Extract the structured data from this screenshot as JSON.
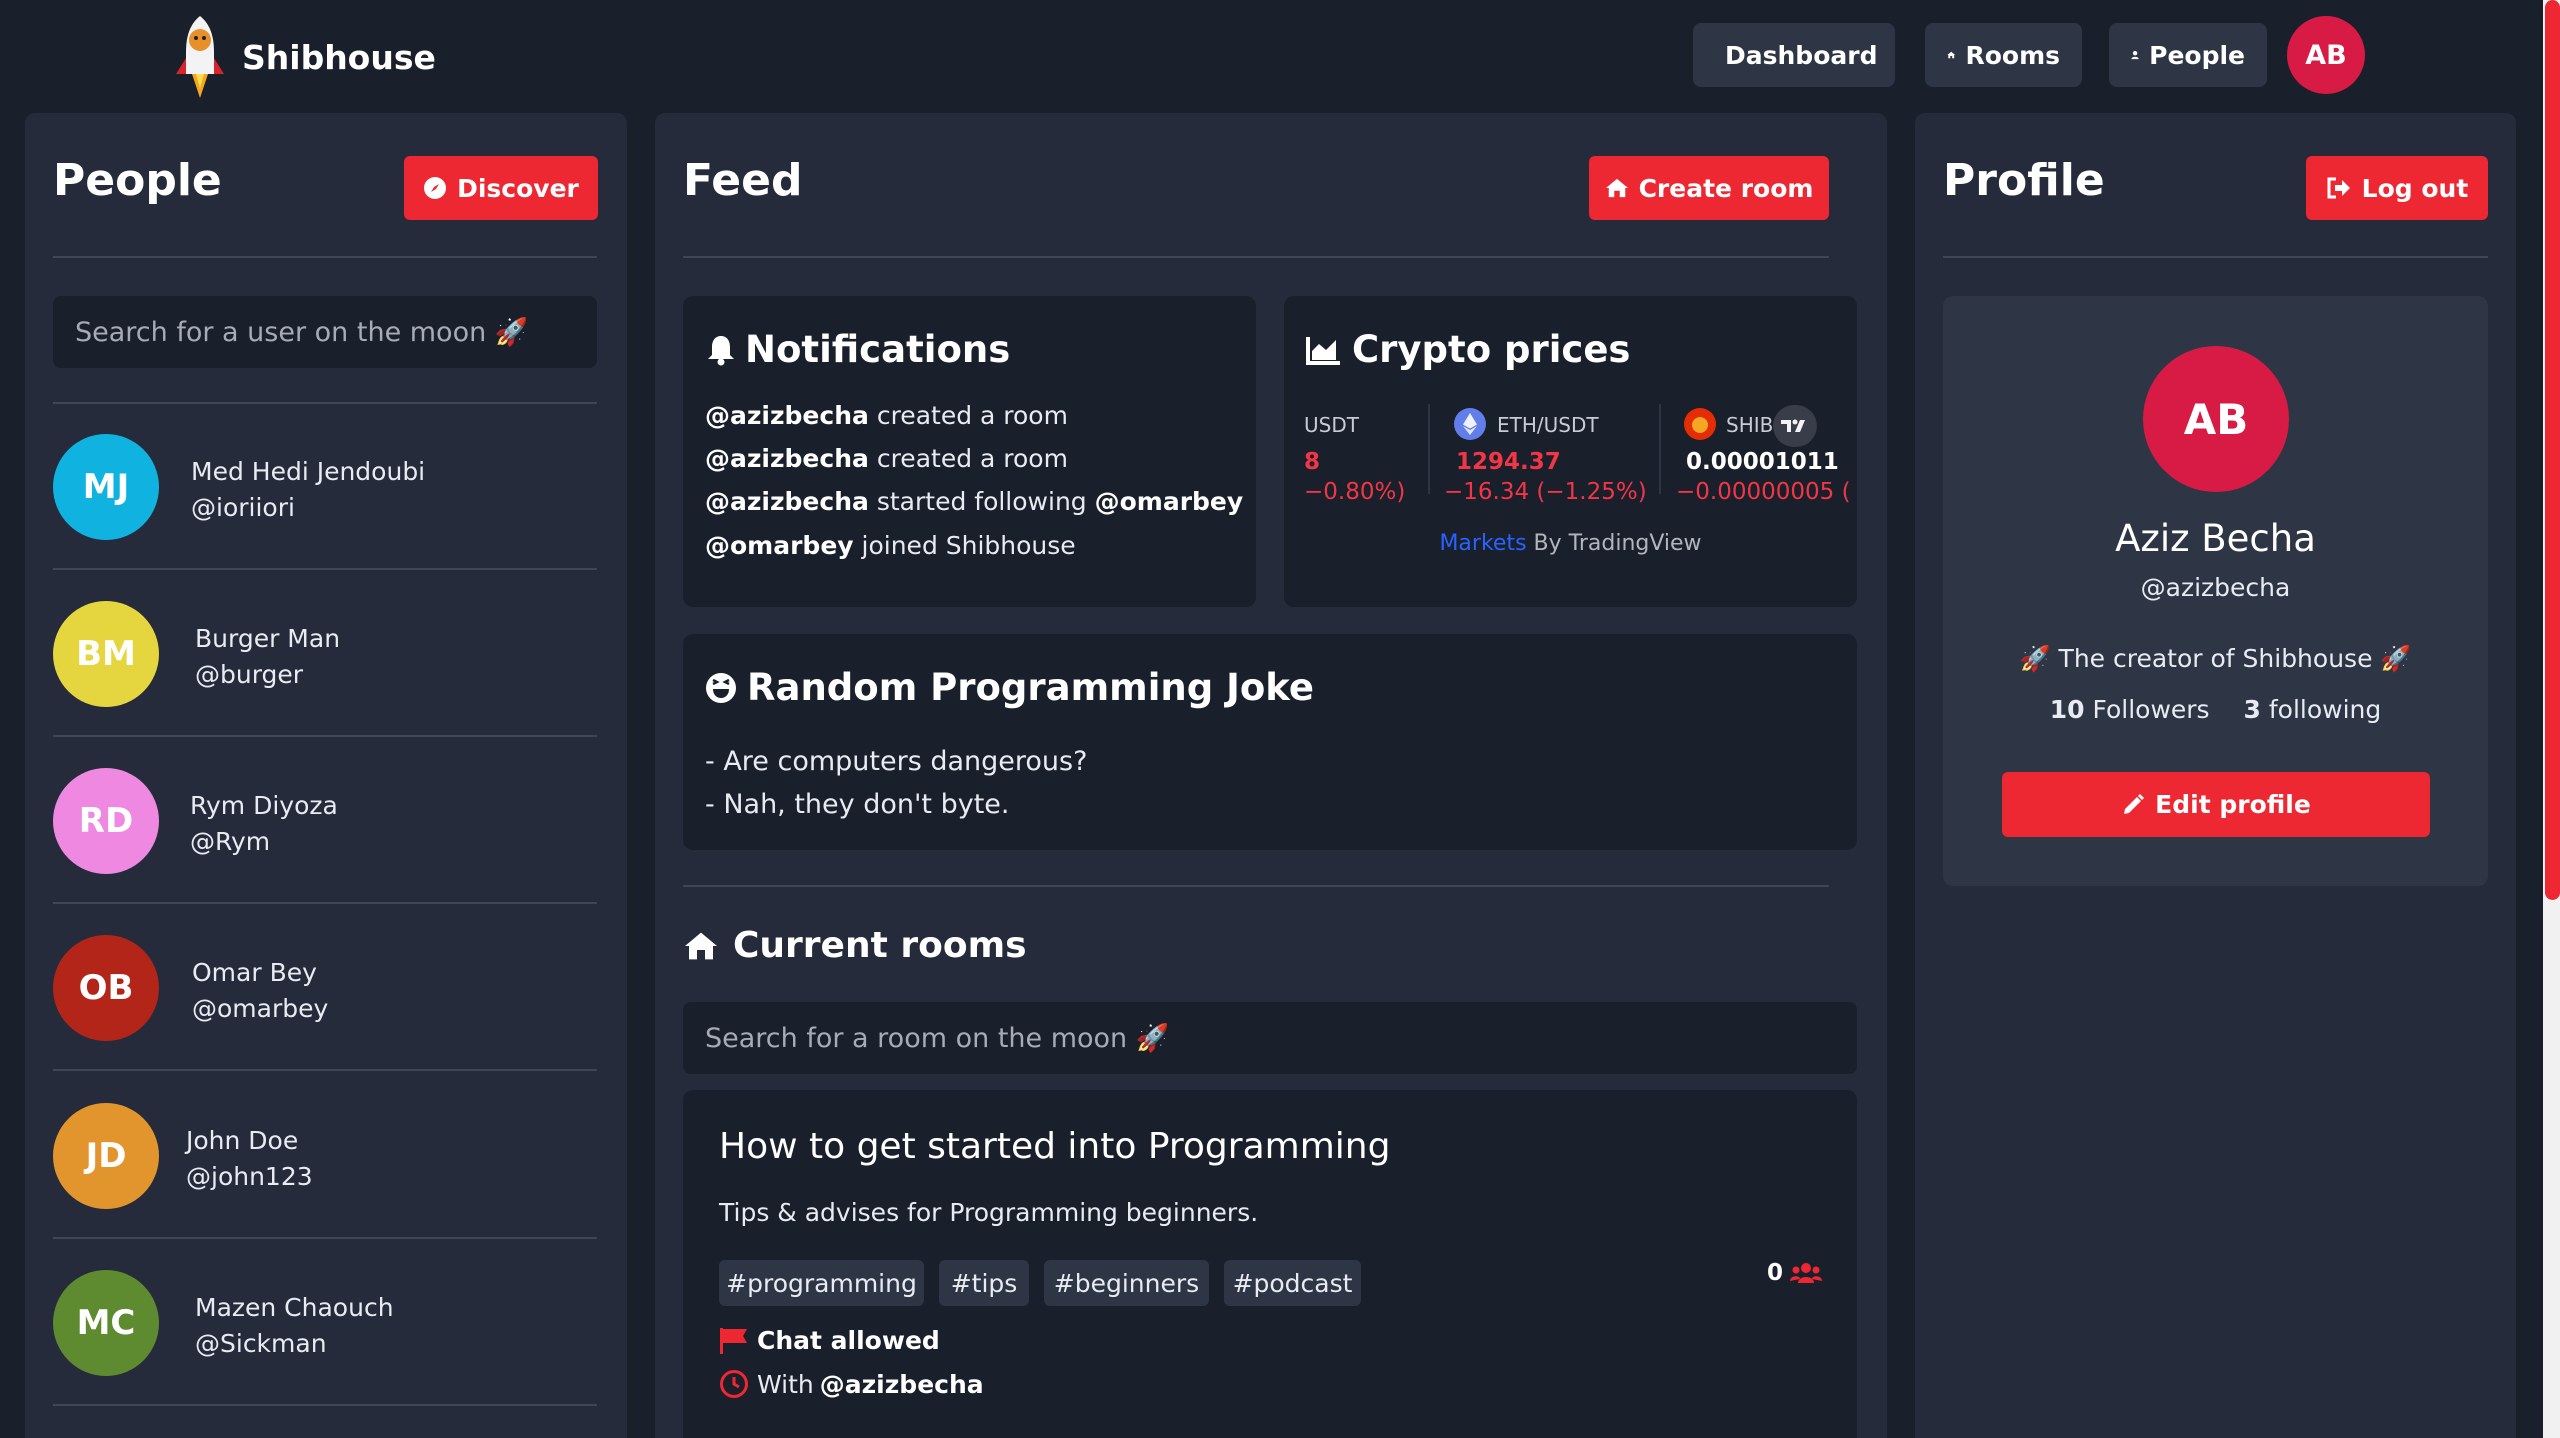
{
  "app": {
    "name": "Shibhouse"
  },
  "nav": {
    "dashboard_label": "Dashboard",
    "rooms_label": "Rooms",
    "people_label": "People",
    "avatar_initials": "AB"
  },
  "people": {
    "title": "People",
    "discover_label": "Discover",
    "search_placeholder": "Search for a user on the moon 🚀",
    "users": [
      {
        "initials": "MJ",
        "name": "Med Hedi Jendoubi",
        "handle": "@ioriiori",
        "color": "#10b3df"
      },
      {
        "initials": "BM",
        "name": "Burger Man",
        "handle": "@burger",
        "color": "#e5d63f"
      },
      {
        "initials": "RD",
        "name": "Rym Diyoza",
        "handle": "@Rym",
        "color": "#ee88e1"
      },
      {
        "initials": "OB",
        "name": "Omar Bey",
        "handle": "@omarbey",
        "color": "#b32519"
      },
      {
        "initials": "JD",
        "name": "John Doe",
        "handle": "@john123",
        "color": "#e2952d"
      },
      {
        "initials": "MC",
        "name": "Mazen Chaouch",
        "handle": "@Sickman",
        "color": "#5e8a30"
      }
    ]
  },
  "feed": {
    "title": "Feed",
    "create_room_label": "Create room",
    "notifications": {
      "title": "Notifications",
      "items": [
        {
          "user": "@azizbecha",
          "text": " created a room",
          "target": ""
        },
        {
          "user": "@azizbecha",
          "text": " created a room",
          "target": ""
        },
        {
          "user": "@azizbecha",
          "text": " started following ",
          "target": "@omarbey"
        },
        {
          "user": "@omarbey",
          "text": " joined Shibhouse",
          "target": ""
        }
      ]
    },
    "crypto": {
      "title": "Crypto prices",
      "tickers": [
        {
          "symbol": "USDT",
          "value": "8",
          "change": "−0.80%)"
        },
        {
          "symbol": "ETH/USDT",
          "value": "1294.37",
          "change": "−16.34 (−1.25%)"
        },
        {
          "symbol": "SHIB",
          "value": "0.00001011",
          "change": "−0.00000005 ("
        }
      ],
      "footer_link": "Markets",
      "footer_text": " By TradingView"
    },
    "joke": {
      "title": "Random Programming Joke",
      "lines": [
        "- Are computers dangerous?",
        "- Nah, they don't byte."
      ]
    },
    "rooms": {
      "title": "Current rooms",
      "search_placeholder": "Search for a room on the moon 🚀",
      "items": [
        {
          "title": "How to get started into Programming",
          "description": "Tips & advises for Programming beginners.",
          "tags": [
            "#programming",
            "#tips",
            "#beginners",
            "#podcast"
          ],
          "listeners": "0",
          "chat_label": "Chat allowed",
          "with_label": "With ",
          "host": "@azizbecha"
        }
      ]
    }
  },
  "profile": {
    "title": "Profile",
    "logout_label": "Log out",
    "initials": "AB",
    "name": "Aziz Becha",
    "handle": "@azizbecha",
    "bio": "🚀 The creator of Shibhouse 🚀",
    "followers_count": "10",
    "followers_label": " Followers",
    "following_count": "3",
    "following_label": " following",
    "edit_label": "Edit profile"
  },
  "colors": {
    "accent": "#ed2833",
    "background": "#1a1f2c",
    "panel": "#252b3a",
    "card": "#2e3545"
  }
}
